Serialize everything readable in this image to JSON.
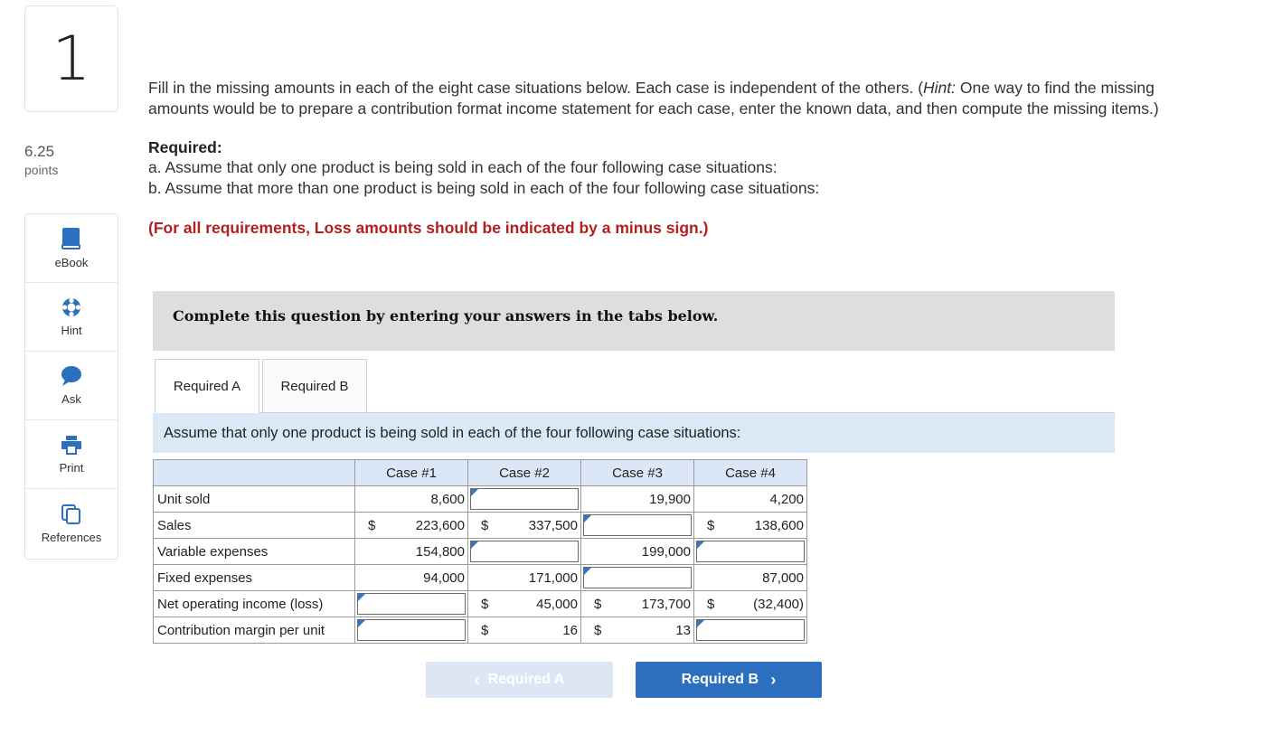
{
  "question": {
    "number": "1",
    "points_value": "6.25",
    "points_label": "points"
  },
  "tools": [
    {
      "label": "eBook",
      "icon": "book-icon"
    },
    {
      "label": "Hint",
      "icon": "lifebuoy-icon"
    },
    {
      "label": "Ask",
      "icon": "chat-bubble-icon"
    },
    {
      "label": "Print",
      "icon": "printer-icon"
    },
    {
      "label": "References",
      "icon": "copy-documents-icon"
    }
  ],
  "content": {
    "intro_start": "Fill in the missing amounts in each of the eight case situations below. Each case is independent of the others. (",
    "intro_hint": "Hint:",
    "intro_end": " One way to find the missing amounts would be to prepare a contribution format income statement for each case, enter the known data, and then compute the missing items.)",
    "required_heading": "Required:",
    "required_a": "a. Assume that only one product is being sold in each of the four following case situations:",
    "required_b": "b. Assume that more than one product is being sold in each of the four following case situations:",
    "loss_note": "(For all requirements, Loss amounts should be indicated by a minus sign.)"
  },
  "banner": "Complete this question by entering your answers in the tabs below.",
  "tabs": [
    "Required A",
    "Required B"
  ],
  "instruction": "Assume that only one product is being sold in each of the four following case situations:",
  "table": {
    "headers": [
      "",
      "Case #1",
      "Case #2",
      "Case #3",
      "Case #4"
    ],
    "rows": [
      {
        "label": "Unit sold",
        "cells": [
          {
            "value": "8,600"
          },
          {
            "input": true
          },
          {
            "value": "19,900"
          },
          {
            "value": "4,200"
          }
        ]
      },
      {
        "label": "Sales",
        "cells": [
          {
            "dollar": "$",
            "value": "223,600"
          },
          {
            "dollar": "$",
            "value": "337,500"
          },
          {
            "input": true
          },
          {
            "dollar": "$",
            "value": "138,600"
          }
        ]
      },
      {
        "label": "Variable expenses",
        "cells": [
          {
            "value": "154,800"
          },
          {
            "input": true
          },
          {
            "value": "199,000"
          },
          {
            "input": true
          }
        ]
      },
      {
        "label": "Fixed expenses",
        "cells": [
          {
            "value": "94,000"
          },
          {
            "value": "171,000"
          },
          {
            "input": true
          },
          {
            "value": "87,000"
          }
        ]
      },
      {
        "label": "Net operating income (loss)",
        "cells": [
          {
            "input": true
          },
          {
            "dollar": "$",
            "value": "45,000"
          },
          {
            "dollar": "$",
            "value": "173,700"
          },
          {
            "dollar": "$",
            "value": "(32,400)"
          }
        ]
      },
      {
        "label": "Contribution margin per unit",
        "cells": [
          {
            "input": true
          },
          {
            "dollar": "$",
            "value": "16"
          },
          {
            "dollar": "$",
            "value": "13"
          },
          {
            "input": true
          }
        ]
      }
    ]
  },
  "nav": {
    "prev_label": "Required A",
    "next_label": "Required B"
  },
  "colors": {
    "accent": "#2d6fbf",
    "loss_red": "#b32020",
    "tab_panel": "#dbe9f7"
  }
}
